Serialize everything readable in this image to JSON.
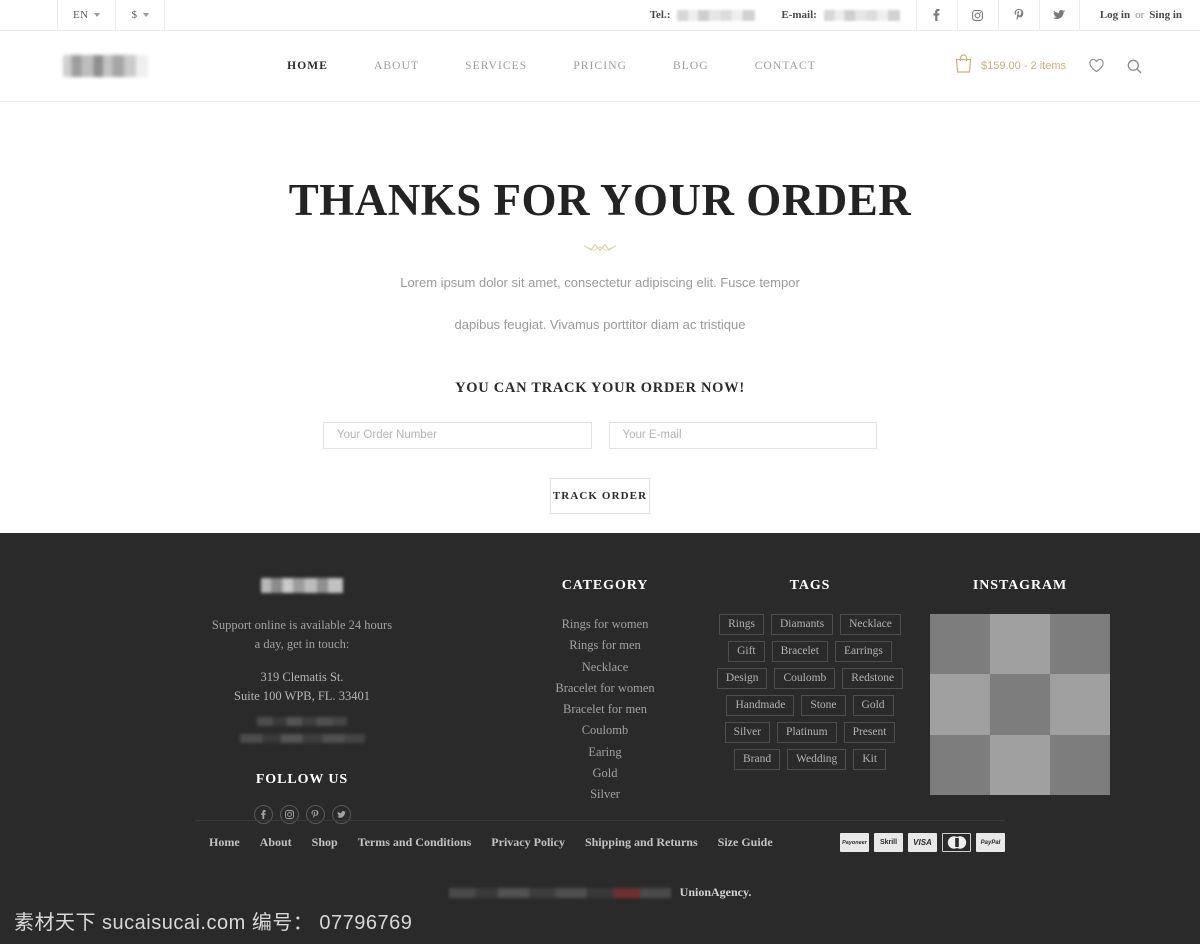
{
  "topbar": {
    "language": "EN",
    "currency": "$",
    "tel_label": "Tel.:",
    "email_label": "E-mail:",
    "social": [
      "facebook-icon",
      "instagram-icon",
      "pinterest-icon",
      "twitter-icon"
    ],
    "login": "Log in",
    "or": "or",
    "signin": "Sing in"
  },
  "header": {
    "nav": [
      {
        "label": "HOME",
        "active": true
      },
      {
        "label": "ABOUT",
        "active": false
      },
      {
        "label": "SERVICES",
        "active": false
      },
      {
        "label": "PRICING",
        "active": false
      },
      {
        "label": "BLOG",
        "active": false
      },
      {
        "label": "CONTACT",
        "active": false
      }
    ],
    "cart_total": "$159.00 - 2 items",
    "cart_icon": "shopping-bag-icon",
    "wishlist_icon": "heart-icon",
    "search_icon": "search-icon",
    "accent_color": "#c9b07c"
  },
  "hero": {
    "title": "THANKS FOR YOUR ORDER",
    "ornament": "crown-divider-icon",
    "paragraph_line1": "Lorem ipsum dolor sit amet, consectetur adipiscing elit. Fusce tempor",
    "paragraph_line2": "dapibus feugiat. Vivamus porttitor diam ac tristique",
    "track_title": "YOU CAN TRACK YOUR ORDER NOW!",
    "order_number_placeholder": "Your Order Number",
    "order_number_value": "",
    "email_placeholder": "Your E-mail",
    "email_value": "",
    "track_button": "TRACK ORDER"
  },
  "footer": {
    "support_line1": "Support online is available 24 hours",
    "support_line2": "a day, get in touch:",
    "address_line1": "319 Clematis St.",
    "address_line2": "Suite 100 WPB, FL. 33401",
    "follow_head": "FOLLOW US",
    "follow_icons": [
      "facebook-icon",
      "instagram-icon",
      "pinterest-icon",
      "twitter-icon"
    ],
    "category_head": "CATEGORY",
    "category_items": [
      "Rings for women",
      "Rings for men",
      "Necklace",
      "Bracelet for women",
      "Bracelet for men",
      "Coulomb",
      "Earing",
      "Gold",
      "Silver"
    ],
    "tags_head": "TAGS",
    "tags": [
      "Rings",
      "Diamants",
      "Necklace",
      "Gift",
      "Bracelet",
      "Earrings",
      "Design",
      "Coulomb",
      "Redstone",
      "Handmade",
      "Stone",
      "Gold",
      "Silver",
      "Platinum",
      "Present",
      "Brand",
      "Wedding",
      "Kit"
    ],
    "instagram_head": "INSTAGRAM",
    "instagram_tiles": [
      "#7d7d7d",
      "#a0a0a0",
      "#7d7d7d",
      "#a0a0a0",
      "#7d7d7d",
      "#a0a0a0",
      "#7d7d7d",
      "#a0a0a0",
      "#7d7d7d"
    ],
    "bottom_nav": [
      "Home",
      "About",
      "Shop",
      "Terms and Conditions",
      "Privacy Policy",
      "Shipping and Returns",
      "Size Guide"
    ],
    "payments": [
      "Payoneer",
      "Skrill",
      "VISA",
      "MasterCard",
      "PayPal"
    ],
    "copyright_brand": "UnionAgency.",
    "background_color": "#2a2a2a"
  },
  "watermark": {
    "text": "素材天下 sucaisucai.com  编号： 07796769"
  }
}
